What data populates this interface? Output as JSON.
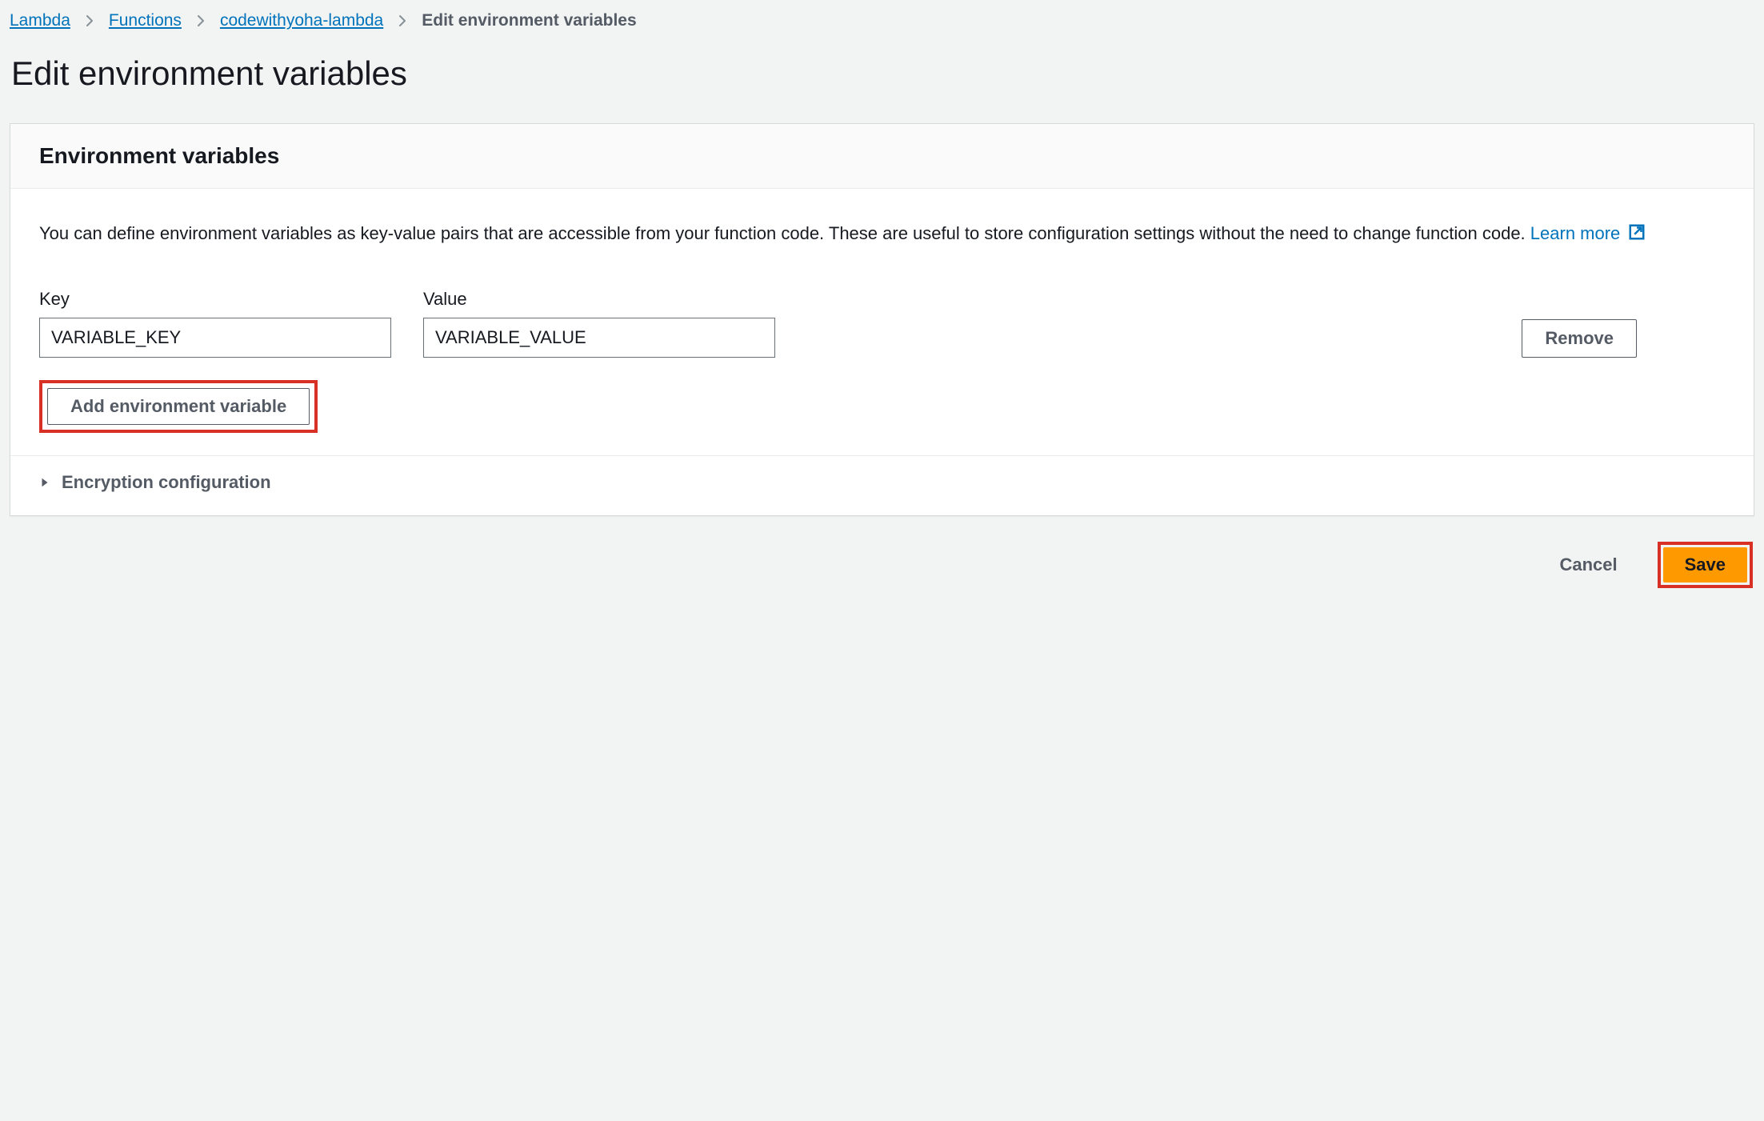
{
  "breadcrumb": {
    "items": [
      {
        "label": "Lambda"
      },
      {
        "label": "Functions"
      },
      {
        "label": "codewithyoha-lambda"
      }
    ],
    "current": "Edit environment variables"
  },
  "page": {
    "title": "Edit environment variables"
  },
  "card": {
    "header": "Environment variables",
    "description": "You can define environment variables as key-value pairs that are accessible from your function code. These are useful to store configuration settings without the need to change function code. ",
    "learn_more": "Learn more"
  },
  "form": {
    "key_label": "Key",
    "value_label": "Value",
    "rows": [
      {
        "key": "VARIABLE_KEY",
        "value": "VARIABLE_VALUE"
      }
    ],
    "remove_label": "Remove",
    "add_label": "Add environment variable"
  },
  "encryption": {
    "title": "Encryption configuration"
  },
  "footer": {
    "cancel": "Cancel",
    "save": "Save"
  }
}
